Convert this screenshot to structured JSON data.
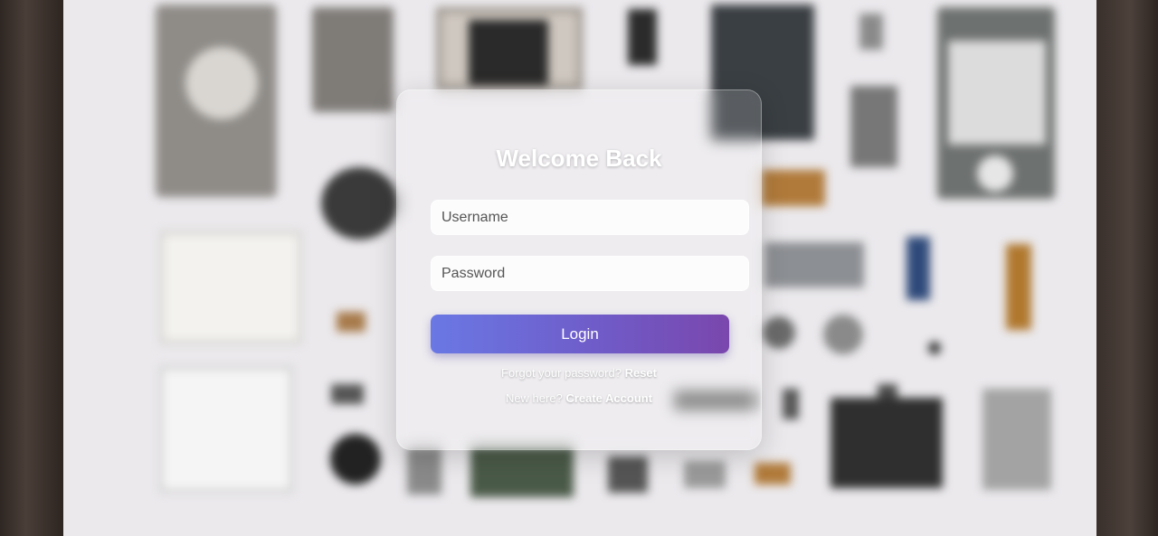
{
  "colors": {
    "button_gradient_start": "#6a78e4",
    "button_gradient_end": "#7a47ad",
    "card_text": "#ffffff"
  },
  "login": {
    "title": "Welcome Back",
    "username_placeholder": "Username",
    "password_placeholder": "Password",
    "submit_label": "Login",
    "forgot_prefix": "Forgot your password?",
    "forgot_link": "Reset",
    "signup_prefix": "New here?",
    "signup_link": "Create Account"
  }
}
